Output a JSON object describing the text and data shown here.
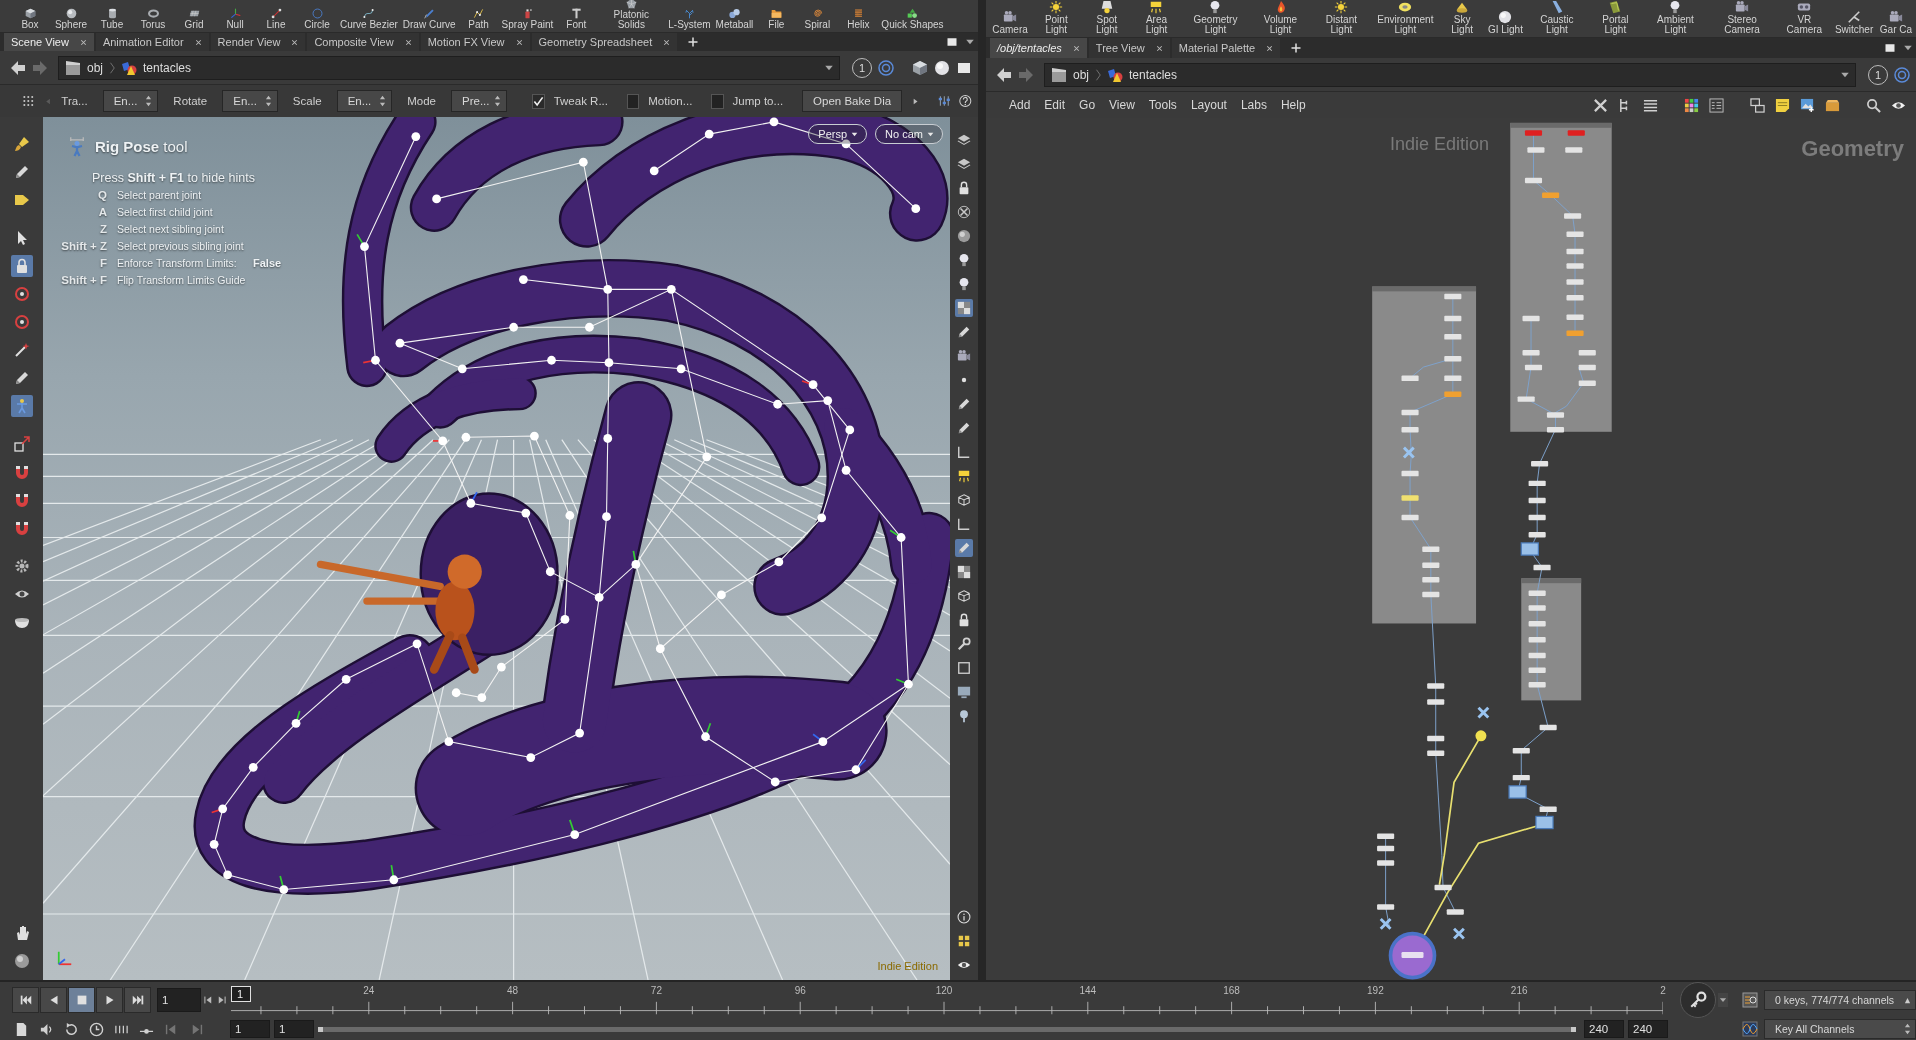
{
  "shelf_left": {
    "tools": [
      {
        "label": "Box"
      },
      {
        "label": "Sphere"
      },
      {
        "label": "Tube"
      },
      {
        "label": "Torus"
      },
      {
        "label": "Grid"
      },
      {
        "label": "Null"
      },
      {
        "label": "Line"
      },
      {
        "label": "Circle"
      },
      {
        "label": "Curve Bezier"
      },
      {
        "label": "Draw Curve"
      },
      {
        "label": "Path"
      },
      {
        "label": "Spray Paint"
      },
      {
        "label": "Font"
      },
      {
        "label": "Platonic Solids"
      },
      {
        "label": "L-System"
      },
      {
        "label": "Metaball"
      },
      {
        "label": "File"
      },
      {
        "label": "Spiral"
      },
      {
        "label": "Helix"
      },
      {
        "label": "Quick Shapes"
      }
    ]
  },
  "shelf_right": {
    "tools": [
      {
        "label": "Camera"
      },
      {
        "label": "Point Light"
      },
      {
        "label": "Spot Light"
      },
      {
        "label": "Area Light"
      },
      {
        "label": "Geometry Light"
      },
      {
        "label": "Volume Light"
      },
      {
        "label": "Distant Light"
      },
      {
        "label": "Environment Light"
      },
      {
        "label": "Sky Light"
      },
      {
        "label": "GI Light"
      },
      {
        "label": "Caustic Light"
      },
      {
        "label": "Portal Light"
      },
      {
        "label": "Ambient Light"
      },
      {
        "label": "Stereo Camera"
      },
      {
        "label": "VR Camera"
      },
      {
        "label": "Switcher"
      },
      {
        "label": "Gar Ca"
      }
    ]
  },
  "scene_pane": {
    "tabs": [
      {
        "label": "Scene View",
        "selected": true
      },
      {
        "label": "Animation Editor",
        "selected": false
      },
      {
        "label": "Render View",
        "selected": false
      },
      {
        "label": "Composite View",
        "selected": false
      },
      {
        "label": "Motion FX View",
        "selected": false
      },
      {
        "label": "Geometry Spreadsheet",
        "selected": false
      }
    ],
    "path": [
      "obj",
      "tentacles"
    ],
    "link_group": "1",
    "tool_options": [
      {
        "kind": "label",
        "text": "Tra..."
      },
      {
        "kind": "dropdown",
        "value": "En..."
      },
      {
        "kind": "label",
        "text": "Rotate"
      },
      {
        "kind": "dropdown",
        "value": "En..."
      },
      {
        "kind": "label",
        "text": "Scale"
      },
      {
        "kind": "dropdown",
        "value": "En..."
      },
      {
        "kind": "label",
        "text": "Mode"
      },
      {
        "kind": "dropdown",
        "value": "Pre..."
      },
      {
        "kind": "checkbox",
        "label": "Tweak R...",
        "checked": true
      },
      {
        "kind": "checkbox",
        "label": "Motion...",
        "checked": false
      },
      {
        "kind": "checkbox",
        "label": "Jump to...",
        "checked": false
      },
      {
        "kind": "button",
        "label": "Open Bake Dia"
      }
    ]
  },
  "viewport": {
    "left_tools": [
      {
        "selected": false
      },
      {
        "selected": false
      },
      {
        "selected": false
      },
      {
        "selected": false
      },
      {
        "selected": true
      },
      {
        "selected": false
      },
      {
        "selected": false
      },
      {
        "selected": false
      },
      {
        "selected": false
      },
      {
        "selected": true
      },
      {
        "selected": false
      },
      {
        "selected": false
      },
      {
        "selected": false
      },
      {
        "selected": false
      },
      {
        "selected": false
      },
      {
        "selected": false
      },
      {
        "selected": false
      },
      {
        "selected": false
      },
      {
        "selected": false
      }
    ],
    "right_tools": [
      {
        "selected": false
      },
      {
        "selected": false
      },
      {
        "selected": false
      },
      {
        "selected": false
      },
      {
        "selected": false
      },
      {
        "selected": false
      },
      {
        "selected": false
      },
      {
        "selected": true
      },
      {
        "selected": false
      },
      {
        "selected": false
      },
      {
        "selected": false
      },
      {
        "selected": false
      },
      {
        "selected": false
      },
      {
        "selected": false
      },
      {
        "selected": false
      },
      {
        "selected": false
      },
      {
        "selected": false
      },
      {
        "selected": true
      },
      {
        "selected": false
      },
      {
        "selected": false
      },
      {
        "selected": false
      },
      {
        "selected": false
      },
      {
        "selected": false
      },
      {
        "selected": false
      },
      {
        "selected": false
      },
      {
        "selected": false
      },
      {
        "selected": false
      },
      {
        "selected": false
      }
    ],
    "hints": {
      "title": "**Rig Pose** tool",
      "press": "Press **Shift + F1** to hide hints",
      "rows": [
        {
          "key": "Q",
          "action": "Select parent joint"
        },
        {
          "key": "A",
          "action": "Select first child joint"
        },
        {
          "key": "Z",
          "action": "Select next sibling joint"
        },
        {
          "key": "Shift + Z",
          "action": "Select previous sibling joint"
        },
        {
          "key": "F",
          "action": "Enforce Transform Limits:",
          "value": "False"
        },
        {
          "key": "Shift + F",
          "action": "Flip Transform Limits Guide"
        }
      ]
    },
    "view_menus": [
      "Persp",
      "No cam"
    ],
    "edition": "Indie Edition"
  },
  "network_pane": {
    "tabs": [
      {
        "label": "/obj/tentacles",
        "selected": true
      },
      {
        "label": "Tree View",
        "selected": false
      },
      {
        "label": "Material Palette",
        "selected": false
      }
    ],
    "path": [
      "obj",
      "tentacles"
    ],
    "link_group": "1",
    "menu": [
      "Add",
      "Edit",
      "Go",
      "View",
      "Tools",
      "Layout",
      "Labs",
      "Help"
    ],
    "edition": "Indie Edition",
    "context": "Geometry"
  },
  "timeline": {
    "transport": [
      {
        "kind": "jump_start",
        "selected": false
      },
      {
        "kind": "play_reverse",
        "selected": false
      },
      {
        "kind": "stop",
        "selected": true
      },
      {
        "kind": "play",
        "selected": false
      },
      {
        "kind": "jump_end",
        "selected": false
      }
    ],
    "frame": "1",
    "marker": "1",
    "ruler_labels": [
      "24",
      "48",
      "72",
      "96",
      "120",
      "144",
      "168",
      "192",
      "216",
      "2"
    ],
    "start_fields": [
      "1",
      "1"
    ],
    "end_fields": [
      "240",
      "240"
    ],
    "keys_status": "0 keys, 774/774 channels",
    "key_mode": "Key All Channels"
  }
}
